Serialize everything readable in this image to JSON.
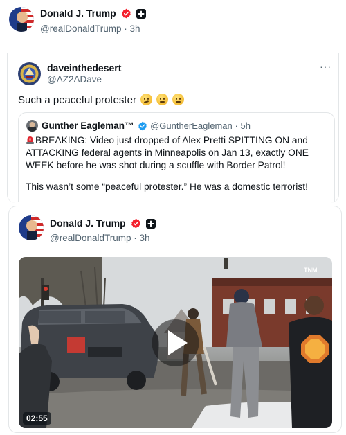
{
  "top_post": {
    "author_name": "Donald J. Trump",
    "author_handle": "@realDonaldTrump",
    "time": "· 3h",
    "badges": [
      "verified-badge-icon",
      "plus-badge-icon"
    ]
  },
  "repost": {
    "author_name": "daveinthedesert",
    "author_handle": "@AZ2ADave",
    "more_label": "···",
    "text": "Such a peaceful protester",
    "emojis": [
      "thinking-face-icon",
      "rolling-eyes-face-icon",
      "rolling-eyes-face-icon"
    ]
  },
  "quoted": {
    "author_name": "Gunther Eagleman™",
    "author_handle": "@GuntherEagleman",
    "time": "· 5h",
    "paragraph1": "BREAKING: Video just dropped of Alex Pretti SPITTING ON and ATTACKING federal agents in Minneapolis on Jan 13, exactly ONE WEEK before he was shot during a scuffle with Border Patrol!",
    "paragraph2": "This wasn’t some “peaceful protester.” He was a domestic terrorist!"
  },
  "embedded": {
    "author_name": "Donald J. Trump",
    "author_handle": "@realDonaldTrump",
    "time": "· 3h",
    "video": {
      "duration": "02:55",
      "watermark": "TNM"
    }
  },
  "colors": {
    "verified_red": "#f4212e",
    "verified_blue": "#1d9bf0",
    "text_primary": "#0f1419",
    "text_secondary": "#536471"
  }
}
